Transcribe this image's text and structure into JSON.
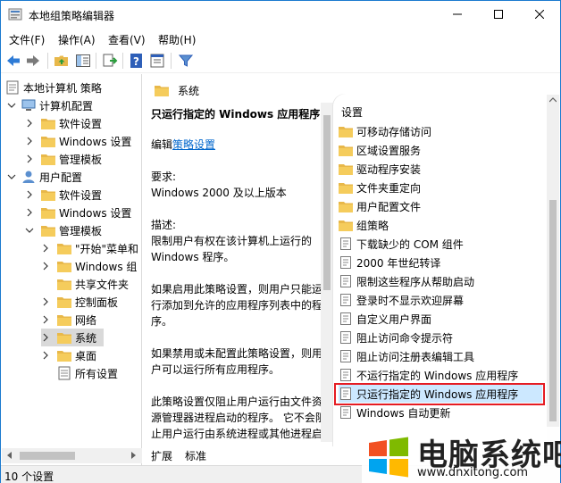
{
  "window": {
    "title": "本地组策略编辑器"
  },
  "menu": [
    "文件(F)",
    "操作(A)",
    "查看(V)",
    "帮助(H)"
  ],
  "tree": {
    "root": "本地计算机 策略",
    "computer_config": "计算机配置",
    "computer_children": [
      "软件设置",
      "Windows 设置",
      "管理模板"
    ],
    "user_config": "用户配置",
    "user_children": [
      "软件设置",
      "Windows 设置",
      "管理模板"
    ],
    "admin_children": [
      "\"开始\"菜单和",
      "Windows 组",
      "共享文件夹",
      "控制面板",
      "网络",
      "系统",
      "桌面",
      "所有设置"
    ]
  },
  "detail": {
    "header": "系统",
    "policy_title": "只运行指定的 Windows 应用程序",
    "edit_prefix": "编辑",
    "edit_link": "策略设置",
    "requirements_label": "要求:",
    "requirements_value": "Windows 2000 及以上版本",
    "description_label": "描述:",
    "paragraphs": [
      "限制用户有权在该计算机上运行的 Windows 程序。",
      "如果启用此策略设置，则用户只能运行添加到允许的应用程序列表中的程序。",
      "如果禁用或未配置此策略设置，则用户可以运行所有应用程序。",
      "此策略设置仅阻止用户运行由文件资源管理器进程启动的程序。 它不会阻止用户运行由系统进程或其他进程启动的程序，如任务管理器。"
    ]
  },
  "list": {
    "column_header": "设置",
    "folders": [
      "可移动存储访问",
      "区域设置服务",
      "驱动程序安装",
      "文件夹重定向",
      "用户配置文件",
      "组策略"
    ],
    "policies": [
      "下载缺少的 COM 组件",
      "2000 年世纪转译",
      "限制这些程序从帮助启动",
      "登录时不显示欢迎屏幕",
      "自定义用户界面",
      "阻止访问命令提示符",
      "阻止访问注册表编辑工具",
      "不运行指定的 Windows 应用程序",
      "只运行指定的 Windows 应用程序",
      "Windows 自动更新"
    ],
    "selected_index": 8
  },
  "tabs": [
    "扩展",
    "标准"
  ],
  "status": "10 个设置",
  "watermark": {
    "title": "电脑系统吧",
    "url": "www.dnxitong.com"
  },
  "colors": {
    "accent": "#1b7acf",
    "selection": "#cce8ff",
    "highlight_border": "#e51c23",
    "folder": "#e8b84a"
  }
}
